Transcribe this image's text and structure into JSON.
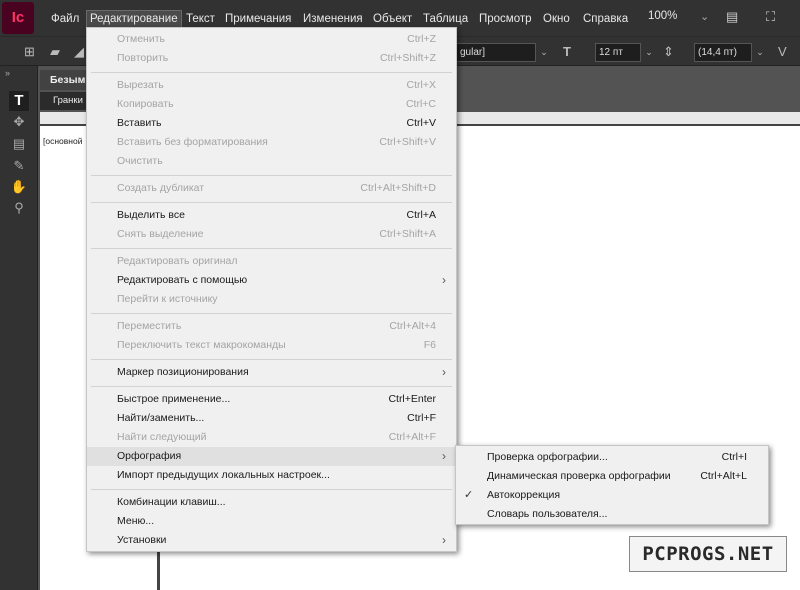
{
  "app": {
    "logo": "Ic"
  },
  "menubar": {
    "items": [
      "Файл",
      "Редактирование",
      "Текст",
      "Примечания",
      "Изменения",
      "Объект",
      "Таблица",
      "Просмотр",
      "Окно",
      "Справка"
    ],
    "zoom": "100%"
  },
  "controlbar": {
    "font_style": "gular]",
    "font_size": "12 пт",
    "leading": "(14,4 пт)"
  },
  "document": {
    "tab_title": "Безым",
    "subtab": "Гранки",
    "frame_label": "[основной"
  },
  "edit_menu": {
    "items": [
      {
        "label": "Отменить",
        "shortcut": "Ctrl+Z",
        "disabled": true
      },
      {
        "label": "Повторить",
        "shortcut": "Ctrl+Shift+Z",
        "disabled": true
      },
      {
        "label": "Вырезать",
        "shortcut": "Ctrl+X",
        "disabled": true
      },
      {
        "label": "Копировать",
        "shortcut": "Ctrl+C",
        "disabled": true
      },
      {
        "label": "Вставить",
        "shortcut": "Ctrl+V",
        "disabled": false
      },
      {
        "label": "Вставить без форматирования",
        "shortcut": "Ctrl+Shift+V",
        "disabled": true
      },
      {
        "label": "Очистить",
        "shortcut": "",
        "disabled": true
      },
      {
        "label": "Создать дубликат",
        "shortcut": "Ctrl+Alt+Shift+D",
        "disabled": true
      },
      {
        "label": "Выделить все",
        "shortcut": "Ctrl+A",
        "disabled": false
      },
      {
        "label": "Снять выделение",
        "shortcut": "Ctrl+Shift+A",
        "disabled": true
      },
      {
        "label": "Редактировать оригинал",
        "shortcut": "",
        "disabled": true
      },
      {
        "label": "Редактировать с помощью",
        "shortcut": "",
        "disabled": false
      },
      {
        "label": "Перейти к источнику",
        "shortcut": "",
        "disabled": true
      },
      {
        "label": "Переместить",
        "shortcut": "Ctrl+Alt+4",
        "disabled": true
      },
      {
        "label": "Переключить текст макрокоманды",
        "shortcut": "F6",
        "disabled": true
      },
      {
        "label": "Маркер позиционирования",
        "shortcut": "",
        "disabled": false
      },
      {
        "label": "Быстрое применение...",
        "shortcut": "Ctrl+Enter",
        "disabled": false
      },
      {
        "label": "Найти/заменить...",
        "shortcut": "Ctrl+F",
        "disabled": false
      },
      {
        "label": "Найти следующий",
        "shortcut": "Ctrl+Alt+F",
        "disabled": true
      },
      {
        "label": "Орфография",
        "shortcut": "",
        "disabled": false
      },
      {
        "label": "Импорт предыдущих локальных настроек...",
        "shortcut": "",
        "disabled": false
      },
      {
        "label": "Комбинации клавиш...",
        "shortcut": "",
        "disabled": false
      },
      {
        "label": "Меню...",
        "shortcut": "",
        "disabled": false
      },
      {
        "label": "Установки",
        "shortcut": "",
        "disabled": false
      }
    ]
  },
  "spelling_submenu": {
    "items": [
      {
        "label": "Проверка орфографии...",
        "shortcut": "Ctrl+I",
        "checked": false
      },
      {
        "label": "Динамическая проверка орфографии",
        "shortcut": "Ctrl+Alt+L",
        "checked": false
      },
      {
        "label": "Автокоррекция",
        "shortcut": "",
        "checked": true
      },
      {
        "label": "Словарь пользователя...",
        "shortcut": "",
        "checked": false
      }
    ]
  },
  "watermark": {
    "text": "PCPROGS.NET"
  },
  "icons": {
    "checkmark": "check-icon",
    "submenu_arrow": "chevron-right-icon"
  }
}
